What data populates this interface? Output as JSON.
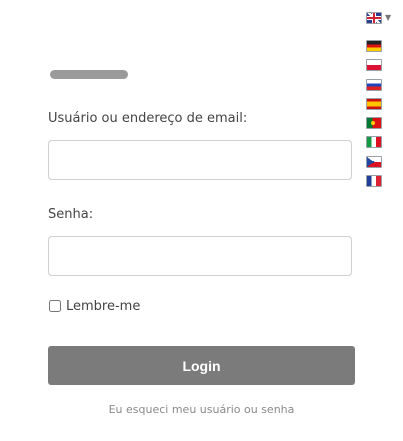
{
  "login_form": {
    "username_label": "Usuário ou endereço de email:",
    "username_value": "",
    "password_label": "Senha:",
    "password_value": "",
    "remember_label": "Lembre-me",
    "remember_checked": false,
    "login_button": "Login",
    "forgot_link": "Eu esqueci meu usuário ou senha"
  },
  "language_selector": {
    "current": "gb-flag-icon",
    "options": [
      "de-flag-icon",
      "pl-flag-icon",
      "ru-flag-icon",
      "es-flag-icon",
      "pt-flag-icon",
      "it-flag-icon",
      "cz-flag-icon",
      "fr-flag-icon"
    ]
  },
  "colors": {
    "button_bg": "#7b7b7b",
    "button_text": "#ffffff",
    "label_text": "#444444",
    "link_text": "#8a8a8a",
    "input_border": "#cfcfcf"
  }
}
